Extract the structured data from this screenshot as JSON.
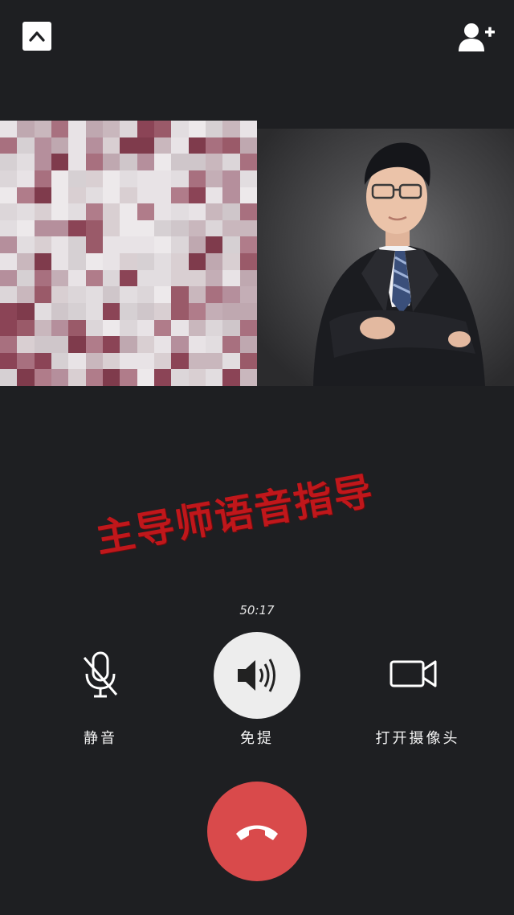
{
  "caption": "主导师语音指导",
  "timer": "50:17",
  "controls": {
    "mute_label": "静音",
    "speaker_label": "免提",
    "camera_label": "打开摄像头"
  },
  "colors": {
    "background": "#1e1f22",
    "hangup": "#d94a4b",
    "speaker_active": "#ededed",
    "caption": "#c0171b"
  },
  "icons": {
    "collapse": "chevron-up-icon",
    "add_member": "add-person-icon",
    "mute": "microphone-off-icon",
    "speaker": "speaker-icon",
    "camera": "video-camera-icon",
    "hangup": "phone-hangup-icon"
  }
}
